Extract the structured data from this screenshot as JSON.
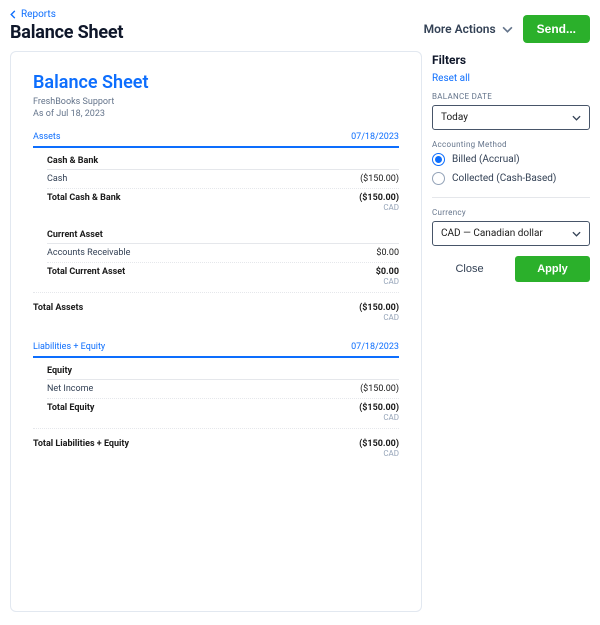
{
  "breadcrumb": {
    "label": "Reports"
  },
  "page": {
    "title": "Balance Sheet"
  },
  "header": {
    "more_actions": "More Actions",
    "send": "Send..."
  },
  "report": {
    "title": "Balance Sheet",
    "company": "FreshBooks Support",
    "asOf": "As of Jul 18, 2023",
    "sections": {
      "assets": {
        "label": "Assets",
        "date": "07/18/2023"
      },
      "liab": {
        "label": "Liabilities + Equity",
        "date": "07/18/2023"
      }
    },
    "cashBank": {
      "head": "Cash & Bank",
      "cashLabel": "Cash",
      "cashValue": "($150.00)",
      "totalLabel": "Total Cash & Bank",
      "totalValue": "($150.00)",
      "currency": "CAD"
    },
    "currentAsset": {
      "head": "Current Asset",
      "arLabel": "Accounts Receivable",
      "arValue": "$0.00",
      "totalLabel": "Total Current Asset",
      "totalValue": "$0.00",
      "currency": "CAD"
    },
    "totalAssets": {
      "label": "Total Assets",
      "value": "($150.00)",
      "currency": "CAD"
    },
    "equity": {
      "head": "Equity",
      "niLabel": "Net Income",
      "niValue": "($150.00)",
      "totalLabel": "Total Equity",
      "totalValue": "($150.00)",
      "currency": "CAD"
    },
    "totalLiab": {
      "label": "Total Liabilities + Equity",
      "value": "($150.00)",
      "currency": "CAD"
    }
  },
  "filters": {
    "title": "Filters",
    "reset": "Reset all",
    "balanceDateLabel": "BALANCE DATE",
    "balanceDateValue": "Today",
    "accountingMethodLabel": "Accounting Method",
    "opt1": "Billed (Accrual)",
    "opt2": "Collected (Cash-Based)",
    "currencyLabel": "Currency",
    "currencyValue": "CAD — Canadian dollar",
    "close": "Close",
    "apply": "Apply"
  }
}
